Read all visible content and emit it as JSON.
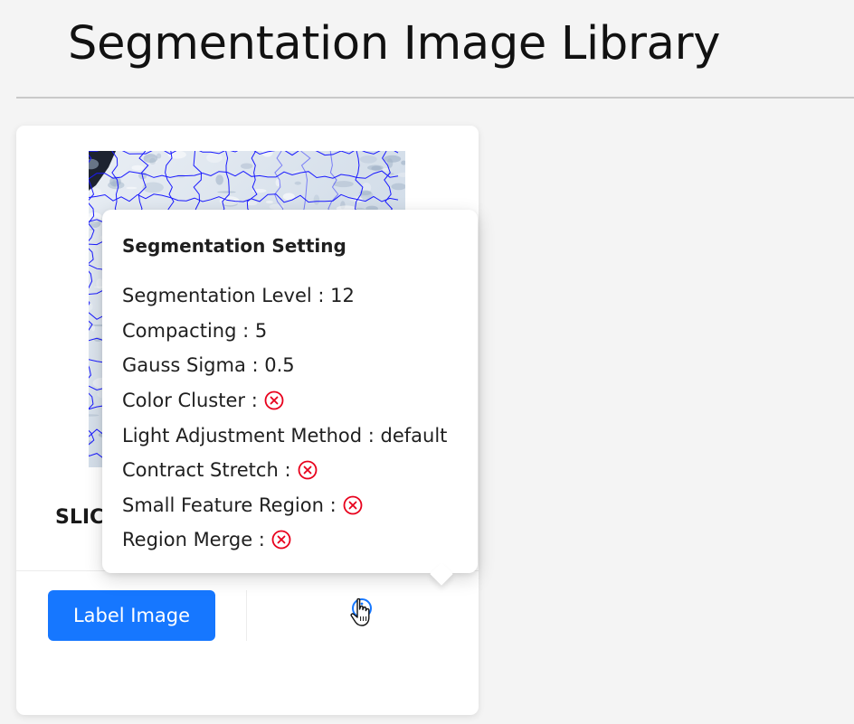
{
  "header": {
    "title": "Segmentation Image Library"
  },
  "card": {
    "title": "SLIC",
    "image_alt": "segmented-satellite-thumbnail",
    "label_button": "Label Image",
    "info_icon": "info-icon"
  },
  "popover": {
    "title": "Segmentation Setting",
    "settings": [
      {
        "label": "Segmentation Level",
        "sep": " : ",
        "value": "12",
        "icon": ""
      },
      {
        "label": "Compacting",
        "sep": " : ",
        "value": "5",
        "icon": ""
      },
      {
        "label": "Gauss Sigma",
        "sep": " : ",
        "value": "0.5",
        "icon": ""
      },
      {
        "label": "Color Cluster",
        "sep": " :",
        "value": "",
        "icon": "close-circle-icon"
      },
      {
        "label": "Light Adjustment Method",
        "sep": " : ",
        "value": "default",
        "icon": ""
      },
      {
        "label": "Contract Stretch",
        "sep": " :",
        "value": "",
        "icon": "close-circle-icon"
      },
      {
        "label": "Small Feature Region",
        "sep": " :",
        "value": "",
        "icon": "close-circle-icon"
      },
      {
        "label": "Region Merge",
        "sep": " :",
        "value": "",
        "icon": "close-circle-icon"
      }
    ]
  },
  "colors": {
    "primary": "#1677ff",
    "error": "#e8001c",
    "segment_line": "#1a1aff"
  }
}
